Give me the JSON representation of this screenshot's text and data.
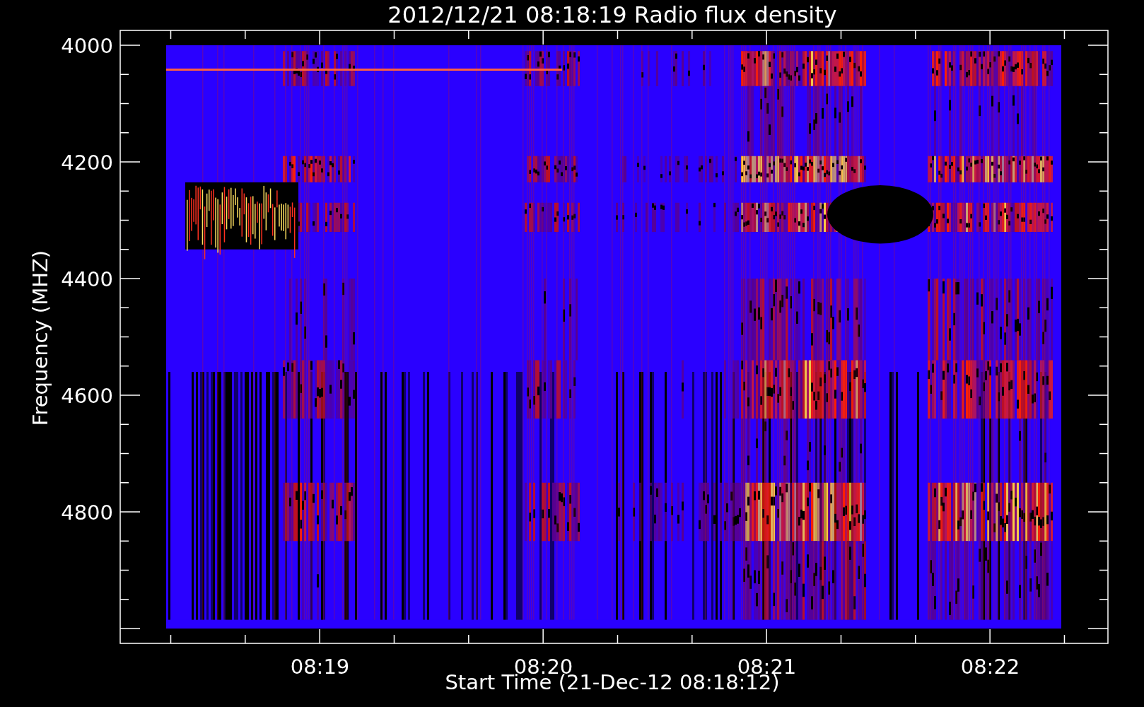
{
  "title": "2012/12/21 08:18:19 Radio flux density",
  "ylabel": "Frequency (MHZ)",
  "xlabel": "Start Time (21-Dec-12 08:18:12)",
  "yticks": [
    "4000",
    "4200",
    "4400",
    "4600",
    "4800"
  ],
  "xticks": [
    "08:19",
    "08:20",
    "08:21",
    "08:22"
  ]
}
